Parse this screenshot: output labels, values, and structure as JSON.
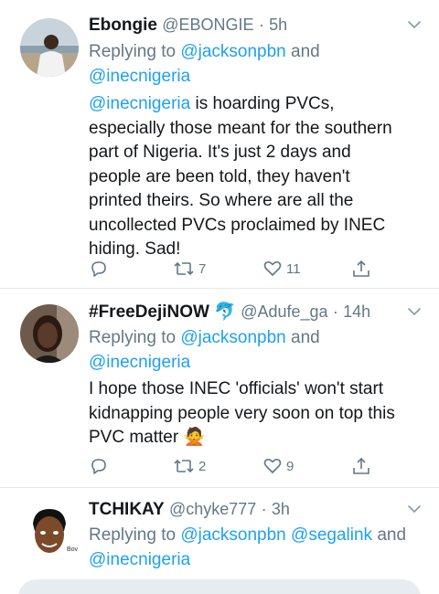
{
  "tweets": [
    {
      "display_name": "Ebongie",
      "handle": "@EBONGIE",
      "separator": "·",
      "time": "5h",
      "replying_prefix": "Replying to ",
      "replying_to": [
        "@jacksonpbn",
        "@inecnigeria"
      ],
      "replying_joiner": " and",
      "body_mention": "@inecnigeria",
      "body_lines": [
        " is hoarding PVCs,",
        "especially those meant for the southern",
        "part of Nigeria. It's just 2 days and",
        "people are been told, they haven't",
        "printed theirs. So where are all the",
        "uncollected PVCs proclaimed by INEC",
        "hiding. Sad!"
      ],
      "retweets": "7",
      "likes": "11",
      "icons": [
        "reply-icon",
        "retweet-icon",
        "like-icon",
        "share-icon"
      ]
    },
    {
      "display_name": "#FreeDejiNOW",
      "name_emoji": "🐬",
      "handle": "@Adufe_ga",
      "separator": "·",
      "time": "14h",
      "replying_prefix": "Replying to ",
      "replying_to": [
        "@jacksonpbn",
        "@inecnigeria"
      ],
      "replying_joiner": " and",
      "body_lines": [
        "I hope those INEC 'officials' won't start",
        "kidnapping people very soon on top this",
        "PVC matter"
      ],
      "body_emoji": "🙅",
      "retweets": "2",
      "likes": "9",
      "icons": [
        "reply-icon",
        "retweet-icon",
        "like-icon",
        "share-icon"
      ]
    },
    {
      "display_name": "TCHIKAY",
      "handle": "@chyke777",
      "separator": "·",
      "time": "3h",
      "replying_prefix": "Replying to ",
      "replying_to": [
        "@jacksonpbn",
        "@segalink",
        "@inecnigeria"
      ],
      "replying_joiner": " and"
    }
  ],
  "colors": {
    "link": "#1da1f2",
    "muted": "#657786",
    "text": "#14171a",
    "divider": "#e1e8ed",
    "compose_bg": "#e6ecf0"
  }
}
